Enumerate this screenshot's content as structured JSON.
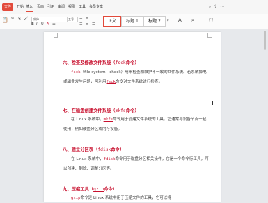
{
  "tabs": {
    "file": "文件",
    "items": [
      "开始",
      "插入",
      "页面",
      "引用",
      "审阅",
      "视图",
      "工具",
      "会员专享"
    ]
  },
  "ribbon": {
    "font_name": "宋体",
    "font_size": "五号",
    "styles": [
      "正文",
      "标题 1",
      "标题 2"
    ]
  },
  "doc": {
    "s6": {
      "title_a": "六、检查及修改文件系统（",
      "cmd": "fsck",
      "title_b": "命令）",
      "p1_cmd": "fsck",
      "p1_text": "（file system　check）用来检查和维护不一致的文件系统。若系统掉电或磁盘发生问题，可利用",
      "p1_cmd2": "fsck",
      "p1_text2": "命令对文件系统进行检查。"
    },
    "s7": {
      "title_a": "七、在磁盘创建文件系统（",
      "cmd": "mkfs",
      "title_b": "命令）",
      "p_a": "在 Linux 系统中，",
      "p_cmd": "mkfs",
      "p_b": "命令用于创建文件系统的工具。它通常与设备节点一起使用，例如硬盘分区或内存设备。"
    },
    "s8": {
      "title_a": "八、建立分区表（",
      "cmd": "fdisk",
      "title_b": "命令）",
      "p_a": "在 Linux 系统中，",
      "p_cmd": "fdisk",
      "p_b": "命令用于磁盘分区相关操作，它是一个命令行工具，可以创建、删除、调整分区等。"
    },
    "s9": {
      "title_a": "九、压缩工具（",
      "cmd": "gzip",
      "title_b": "命令）",
      "p_cmd": "gzip",
      "p_b": "命令是 Linux 系统中用于压缩文件的工具，它可以将"
    }
  }
}
